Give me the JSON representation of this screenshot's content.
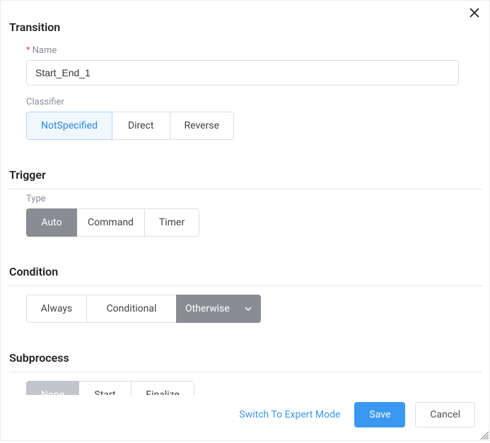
{
  "header": {
    "close_icon": "close"
  },
  "transition": {
    "title": "Transition",
    "name_label": "Name",
    "name_value": "Start_End_1",
    "classifier_label": "Classifier",
    "classifier_options": [
      "NotSpecified",
      "Direct",
      "Reverse"
    ],
    "classifier_selected": "NotSpecified"
  },
  "trigger": {
    "title": "Trigger",
    "type_label": "Type",
    "type_options": [
      "Auto",
      "Command",
      "Timer"
    ],
    "type_selected": "Auto"
  },
  "condition": {
    "title": "Condition",
    "options": [
      "Always",
      "Conditional",
      "Otherwise"
    ],
    "selected": "Otherwise"
  },
  "subprocess": {
    "title": "Subprocess",
    "options": [
      "None",
      "Start",
      "Finalize"
    ],
    "selected": "None"
  },
  "footer": {
    "expert_link": "Switch To Expert Mode",
    "save_label": "Save",
    "cancel_label": "Cancel"
  }
}
